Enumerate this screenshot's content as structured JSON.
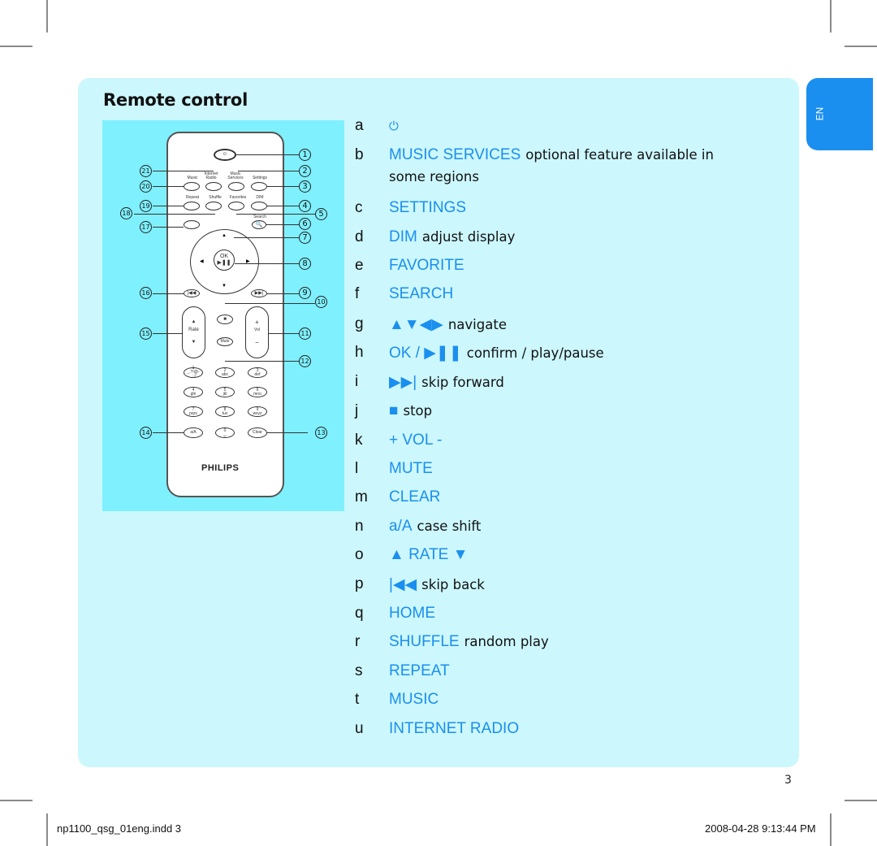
{
  "document": {
    "title": "Remote control",
    "language_tab": "EN",
    "page_number": "3",
    "footer_left": "np1100_qsg_01eng.indd   3",
    "footer_right": "2008-04-28   9:13:44 PM",
    "accent_color": "#1a8fef",
    "panel_color": "#ccf7fd",
    "image_bg_color": "#7ff0fd"
  },
  "remote": {
    "brand": "PHILIPS",
    "button_labels": {
      "music": "Music",
      "internet_radio": "Internet Radio",
      "music_services": "Music Services",
      "settings": "Settings",
      "repeat": "Repeat",
      "shuffle": "Shuffle",
      "favorites": "Favorites",
      "dim": "DIM",
      "search": "Search",
      "ok": "OK",
      "rate": "Rate",
      "vol": "Vol",
      "mute": "Mute",
      "clear": "Clear",
      "case": "a/A"
    },
    "keypad": [
      {
        "num": "1",
        "letters": "_.?!@-_:;/"
      },
      {
        "num": "2",
        "letters": "abc"
      },
      {
        "num": "3",
        "letters": "def"
      },
      {
        "num": "4",
        "letters": "ghi"
      },
      {
        "num": "5",
        "letters": "jkl"
      },
      {
        "num": "6",
        "letters": "mno"
      },
      {
        "num": "7",
        "letters": "pqrs"
      },
      {
        "num": "8",
        "letters": "tuv"
      },
      {
        "num": "9",
        "letters": "wxyz"
      },
      {
        "num": "0",
        "letters": "␣"
      }
    ],
    "callouts": [
      "1",
      "2",
      "3",
      "4",
      "5",
      "6",
      "7",
      "8",
      "9",
      "10",
      "11",
      "12",
      "13",
      "14",
      "15",
      "16",
      "17",
      "18",
      "19",
      "20",
      "21"
    ]
  },
  "legend": [
    {
      "letter": "a",
      "key": "⏻",
      "desc": ""
    },
    {
      "letter": "b",
      "key": "MUSIC SERVICES",
      "desc": "optional feature available in",
      "desc2": "some regions"
    },
    {
      "letter": "c",
      "key": "SETTINGS",
      "desc": ""
    },
    {
      "letter": "d",
      "key": "DIM",
      "desc": "adjust display"
    },
    {
      "letter": "e",
      "key": "FAVORITE",
      "desc": ""
    },
    {
      "letter": "f",
      "key": "SEARCH",
      "desc": ""
    },
    {
      "letter": "g",
      "key": "▲▼◀▶",
      "desc": "navigate"
    },
    {
      "letter": "h",
      "key": "OK / ▶❚❚",
      "desc": "confirm / play/pause"
    },
    {
      "letter": "i",
      "key": "▶▶|",
      "desc": "skip forward"
    },
    {
      "letter": "j",
      "key": "■",
      "desc": "stop"
    },
    {
      "letter": "k",
      "key": "+ VOL -",
      "desc": ""
    },
    {
      "letter": "l",
      "key": "MUTE",
      "desc": ""
    },
    {
      "letter": "m",
      "key": "CLEAR",
      "desc": ""
    },
    {
      "letter": "n",
      "key": "a/A",
      "desc": "case shift"
    },
    {
      "letter": "o",
      "key": "▲ RATE ▼",
      "desc": ""
    },
    {
      "letter": "p",
      "key": "|◀◀",
      "desc": "skip back"
    },
    {
      "letter": "q",
      "key": "HOME",
      "desc": ""
    },
    {
      "letter": "r",
      "key": "SHUFFLE",
      "desc": "random play"
    },
    {
      "letter": "s",
      "key": "REPEAT",
      "desc": ""
    },
    {
      "letter": "t",
      "key": "MUSIC",
      "desc": ""
    },
    {
      "letter": "u",
      "key": "INTERNET RADIO",
      "desc": ""
    }
  ]
}
